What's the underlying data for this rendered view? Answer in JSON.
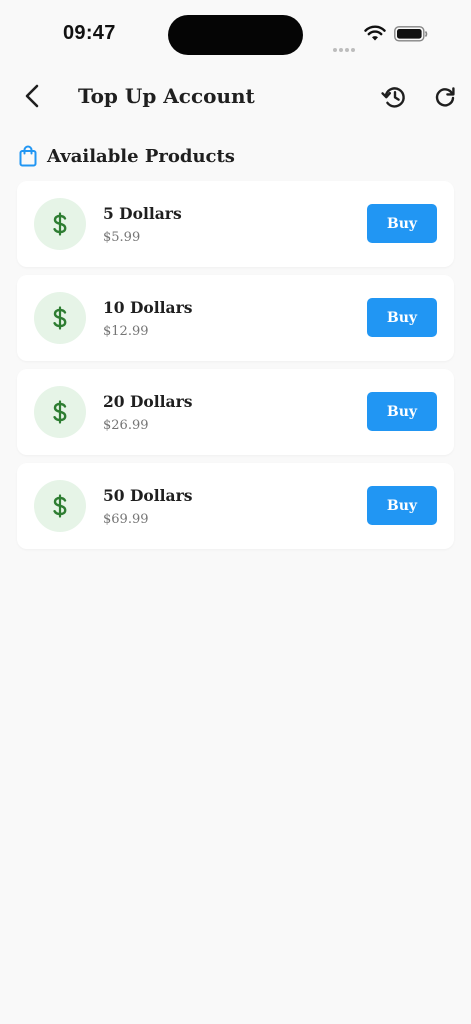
{
  "status_bar": {
    "time": "09:47"
  },
  "app_bar": {
    "title": "Top Up Account"
  },
  "section": {
    "title": "Available Products"
  },
  "products": [
    {
      "name": "5 Dollars",
      "price": "$5.99",
      "button": "Buy"
    },
    {
      "name": "10 Dollars",
      "price": "$12.99",
      "button": "Buy"
    },
    {
      "name": "20 Dollars",
      "price": "$26.99",
      "button": "Buy"
    },
    {
      "name": "50 Dollars",
      "price": "$69.99",
      "button": "Buy"
    }
  ],
  "colors": {
    "accent": "#2196f3",
    "icon_green": "#2e7d32",
    "icon_bg": "#e6f4e7",
    "background": "#f9f9f9"
  },
  "icons": {
    "back": "arrow-back-icon",
    "history": "history-icon",
    "refresh": "refresh-icon",
    "section": "shopping-bag-icon",
    "product": "dollar-icon"
  }
}
